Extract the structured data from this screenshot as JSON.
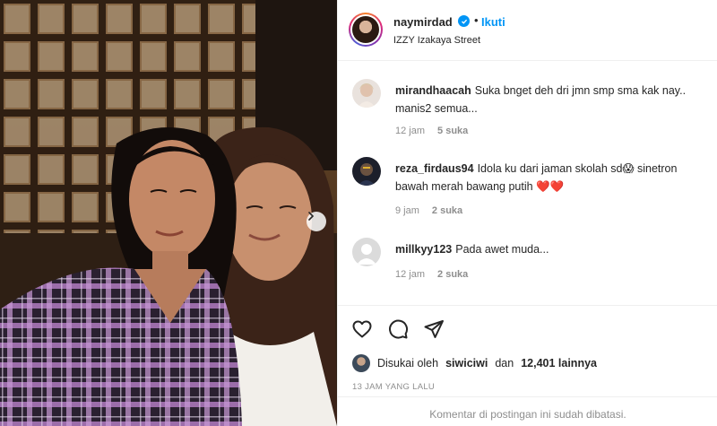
{
  "post": {
    "author": "naymirdad",
    "follow_label": "Ikuti",
    "dot": "•",
    "location": "IZZY Izakaya Street"
  },
  "comments": [
    {
      "username": "mirandhaacah",
      "text": "Suka bnget deh dri jmn smp sma kak nay.. manis2 semua...",
      "time": "12 jam",
      "likes": "5 suka"
    },
    {
      "username": "reza_firdaus94",
      "text": "Idola ku dari jaman skolah sd😱 sinetron bawah merah bawang putih ❤️❤️",
      "time": "9 jam",
      "likes": "2 suka"
    },
    {
      "username": "millkyy123",
      "text": "Pada awet muda...",
      "time": "12 jam",
      "likes": "2 suka"
    }
  ],
  "likes": {
    "prefix": "Disukai oleh",
    "user": "siwiciwi",
    "conjunction": "dan",
    "count": "12,401 lainnya"
  },
  "timestamp": "13 JAM YANG LALU",
  "comments_limited": "Komentar di postingan ini sudah dibatasi.",
  "icons": {
    "like": "heart-icon",
    "comment": "comment-icon",
    "share": "send-icon",
    "verified": "verified-badge-icon",
    "next": "chevron-right-icon"
  },
  "colors": {
    "link_blue": "#0095f6",
    "text": "#262626",
    "muted": "#8e8e8e",
    "divider": "#efefef",
    "plaid": "#b07ac0"
  }
}
